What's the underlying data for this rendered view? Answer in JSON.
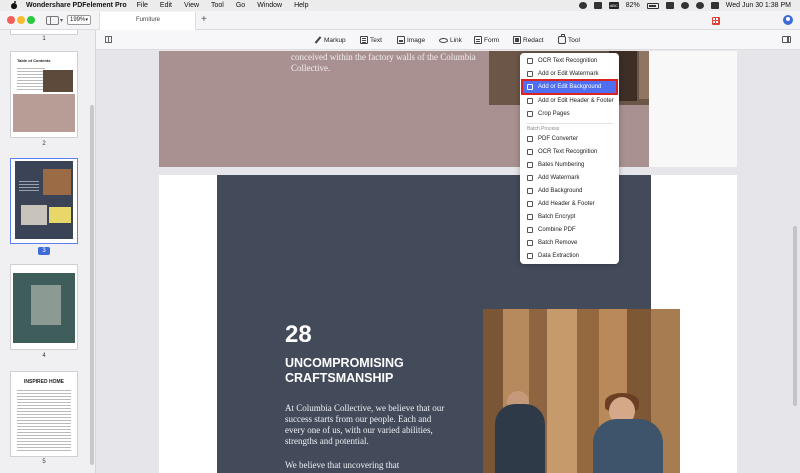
{
  "menubar": {
    "app_name": "Wondershare PDFelement Pro",
    "items": [
      "File",
      "Edit",
      "View",
      "Tool",
      "Go",
      "Window",
      "Help"
    ],
    "keyboard_label": "ABC",
    "battery": "82%",
    "clock": "Wed Jun 30  1:38 PM"
  },
  "titlebar": {
    "zoom": "199%",
    "tab_title": "Furniture",
    "add_tab": "+"
  },
  "toolbar": {
    "buttons": [
      "Markup",
      "Text",
      "Image",
      "Link",
      "Form",
      "Redact",
      "Tool"
    ]
  },
  "sidebar": {
    "pages": [
      {
        "num": "1"
      },
      {
        "num": "2",
        "title": "Table of Contents"
      },
      {
        "num": "3",
        "selected": true
      },
      {
        "num": "4"
      },
      {
        "num": "5",
        "title": "INSPIRED HOME"
      }
    ]
  },
  "document": {
    "prev_page_text": "brought to life in the spirit of every design conceived within the factory walls of the Columbia Collective.",
    "page_number": "28",
    "heading": "UNCOMPROMISING CRAFTSMANSHIP",
    "para1": "At Columbia Collective, we believe that our success starts from our people. Each and every one of us, with our varied abilities, strengths and potential.",
    "para2": "We believe that uncovering that"
  },
  "tool_menu": {
    "items_top": [
      {
        "label": "OCR Text Recognition",
        "icon": "ocr-icon"
      },
      {
        "label": "Add or Edit Watermark",
        "icon": "watermark-icon"
      },
      {
        "label": "Add or Edit Background",
        "icon": "background-icon",
        "selected": true
      },
      {
        "label": "Add or Edit Header & Footer",
        "icon": "header-footer-icon"
      },
      {
        "label": "Crop Pages",
        "icon": "crop-icon"
      }
    ],
    "group_label": "Batch Process",
    "items_batch": [
      {
        "label": "PDF Converter",
        "icon": "converter-icon"
      },
      {
        "label": "OCR Text Recognition",
        "icon": "ocr-icon"
      },
      {
        "label": "Bates Numbering",
        "icon": "bates-icon"
      },
      {
        "label": "Add Watermark",
        "icon": "watermark-icon"
      },
      {
        "label": "Add Background",
        "icon": "background-icon"
      },
      {
        "label": "Add Header & Footer",
        "icon": "header-footer-icon"
      },
      {
        "label": "Batch Encrypt",
        "icon": "lock-icon"
      },
      {
        "label": "Combine PDF",
        "icon": "combine-icon"
      },
      {
        "label": "Batch Remove",
        "icon": "remove-icon"
      },
      {
        "label": "Data Extraction",
        "icon": "extract-icon"
      }
    ]
  },
  "colors": {
    "accent": "#4f6ff2",
    "highlight_border": "#dd2222",
    "dark_panel": "#434b5b",
    "prev_page": "#a89190"
  }
}
